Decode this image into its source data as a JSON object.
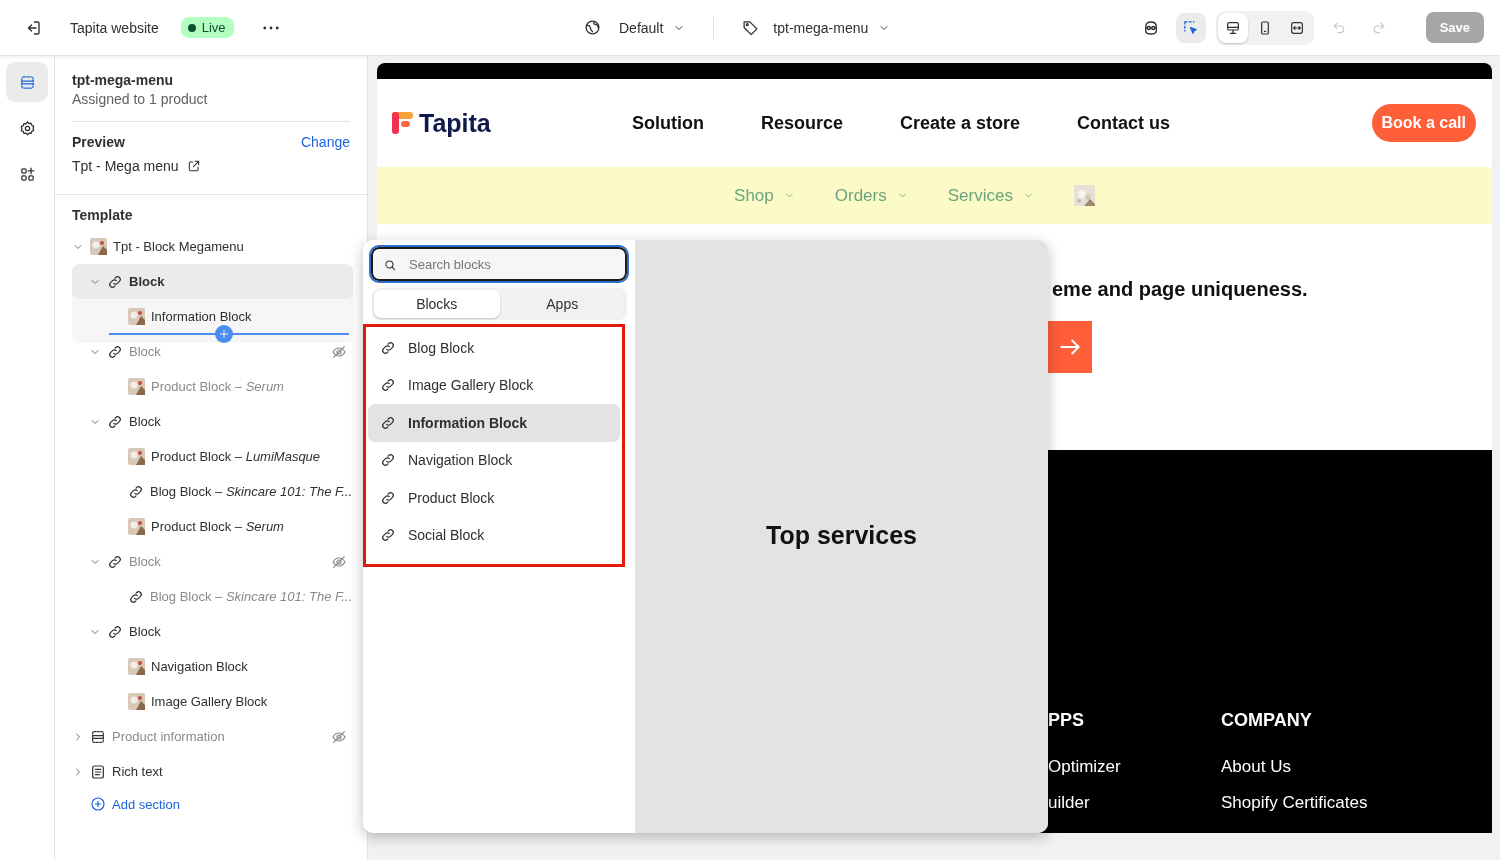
{
  "topbar": {
    "site_name": "Tapita website",
    "status": "Live",
    "theme": "Default",
    "template": "tpt-mega-menu",
    "devices": [
      {
        "kind": "desktop",
        "selected": true
      },
      {
        "kind": "mobile",
        "selected": false
      },
      {
        "kind": "fit",
        "selected": false
      }
    ],
    "tools": [
      {
        "kind": "select",
        "selected": true
      }
    ],
    "undo": {
      "disabled": true
    },
    "redo": {
      "disabled": true
    },
    "save": {
      "label": "Save",
      "disabled": true
    }
  },
  "rail": [
    {
      "kind": "sections",
      "selected": true
    },
    {
      "kind": "settings",
      "selected": false
    },
    {
      "kind": "apps",
      "selected": false
    }
  ],
  "panel": {
    "title": "tpt-mega-menu",
    "subtitle": "Assigned to 1 product",
    "preview_label": "Preview",
    "change_link": "Change",
    "preview_value": "Tpt - Mega menu",
    "template_heading": "Template",
    "tree": [
      {
        "label": "Tpt - Block Megamenu",
        "kind": "thumb",
        "expanded": true,
        "hidden": false,
        "selected": false,
        "children": [
          {
            "label": "Block",
            "kind": "link",
            "expanded": true,
            "hidden": false,
            "selected": true,
            "children": [
              {
                "label": "Information Block",
                "kind": "thumb",
                "hidden": false,
                "selected": false,
                "dragging": true
              }
            ]
          },
          {
            "label": "Block",
            "kind": "link",
            "expanded": true,
            "hidden": true,
            "selected": false,
            "children": [
              {
                "label": "Product Block – *Serum*",
                "kind": "thumb",
                "hidden": false,
                "selected": false
              }
            ]
          },
          {
            "label": "Block",
            "kind": "link",
            "expanded": true,
            "hidden": false,
            "selected": false,
            "children": [
              {
                "label": "Product Block – *LumiMasque*",
                "kind": "thumb",
                "hidden": false,
                "selected": false
              },
              {
                "label": "Blog Block – *Skincare 101: The F...*",
                "kind": "link",
                "hidden": false,
                "selected": false
              },
              {
                "label": "Product Block – *Serum*",
                "kind": "thumb",
                "hidden": false,
                "selected": false
              }
            ]
          },
          {
            "label": "Block",
            "kind": "link",
            "expanded": true,
            "hidden": true,
            "selected": false,
            "children": [
              {
                "label": "Blog Block – *Skincare 101: The F...*",
                "kind": "link",
                "hidden": false,
                "selected": false
              }
            ]
          },
          {
            "label": "Block",
            "kind": "link",
            "expanded": true,
            "hidden": false,
            "selected": false,
            "children": [
              {
                "label": "Navigation Block",
                "kind": "thumb",
                "hidden": false,
                "selected": false
              },
              {
                "label": "Image Gallery Block",
                "kind": "thumb",
                "hidden": false,
                "selected": false
              }
            ]
          }
        ]
      },
      {
        "label": "Product information",
        "kind": "section",
        "expanded": false,
        "hidden": true,
        "selected": false
      },
      {
        "label": "Rich text",
        "kind": "text",
        "expanded": false,
        "hidden": false,
        "selected": false
      }
    ],
    "add_section": "Add section"
  },
  "site": {
    "logo": "Tapita",
    "nav": [
      "Solution",
      "Resource",
      "Create a store",
      "Contact us"
    ],
    "cta": "Book a call",
    "menu": [
      "Shop",
      "Orders",
      "Services"
    ],
    "hero_title": "eme and page uniqueness.",
    "footer_columns": [
      {
        "heading": "PPS",
        "links": [
          "Optimizer",
          "uilder"
        ]
      },
      {
        "heading": "COMPANY",
        "links": [
          "About Us",
          "Shopify Certificates"
        ]
      }
    ]
  },
  "popover": {
    "search_placeholder": "Search blocks",
    "tabs": [
      {
        "label": "Blocks",
        "selected": true
      },
      {
        "label": "Apps",
        "selected": false
      }
    ],
    "blocks": [
      {
        "label": "Blog Block",
        "selected": false
      },
      {
        "label": "Image Gallery Block",
        "selected": false
      },
      {
        "label": "Information Block",
        "selected": true
      },
      {
        "label": "Navigation Block",
        "selected": false
      },
      {
        "label": "Product Block",
        "selected": false
      },
      {
        "label": "Social Block",
        "selected": false
      }
    ],
    "preview_title": "Top services"
  }
}
